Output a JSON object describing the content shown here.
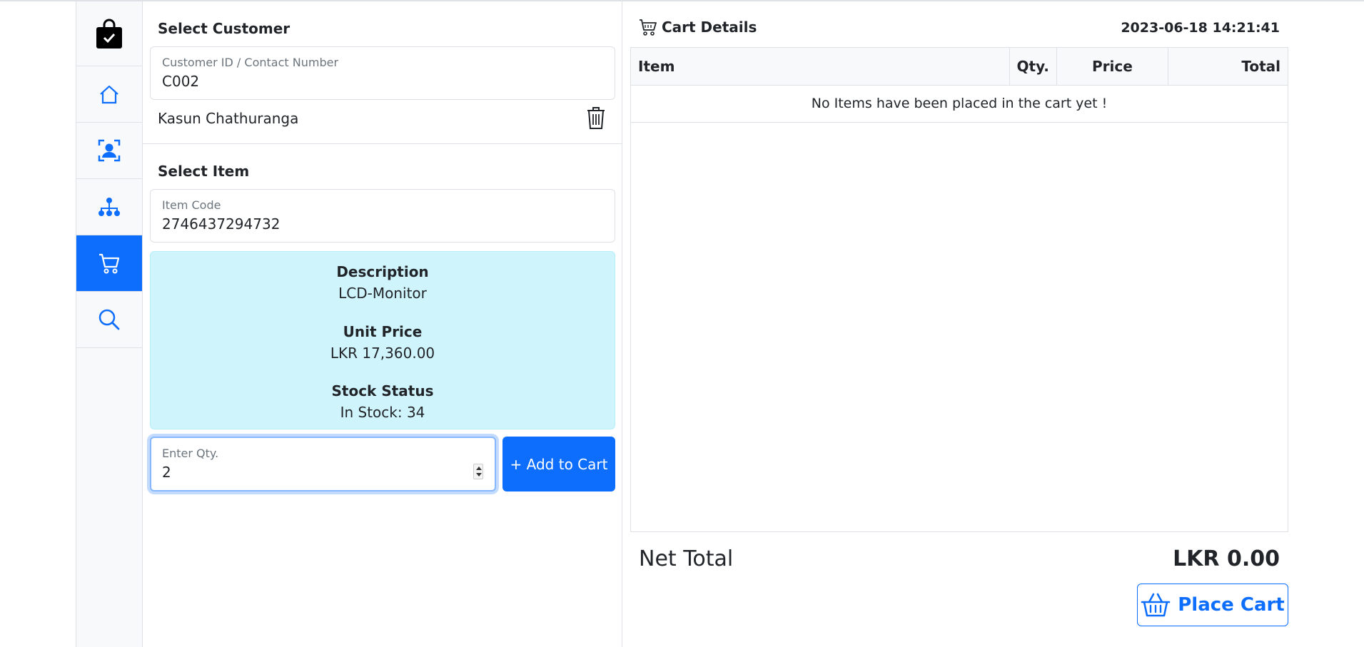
{
  "sidebar": {
    "items": [
      {
        "icon": "bag-check-icon"
      },
      {
        "icon": "home-icon"
      },
      {
        "icon": "person-badge-icon"
      },
      {
        "icon": "diagram-icon"
      },
      {
        "icon": "cart-icon",
        "active": true
      },
      {
        "icon": "search-icon"
      }
    ]
  },
  "customer": {
    "title": "Select Customer",
    "field_label": "Customer ID / Contact Number",
    "field_value": "C002",
    "name": "Kasun Chathuranga"
  },
  "item": {
    "title": "Select Item",
    "code_label": "Item Code",
    "code_value": "2746437294732",
    "description_label": "Description",
    "description_value": "LCD-Monitor",
    "price_label": "Unit Price",
    "price_value": "LKR 17,360.00",
    "stock_label": "Stock Status",
    "stock_value": "In Stock: 34",
    "qty_label": "Enter Qty.",
    "qty_value": "2",
    "add_button": "+ Add to Cart"
  },
  "cart": {
    "title": "Cart Details",
    "datetime": "2023-06-18 14:21:41",
    "columns": [
      "Item",
      "Qty.",
      "Price",
      "Total"
    ],
    "empty_message": "No Items have been placed in the cart yet !",
    "net_total_label": "Net Total",
    "net_total_value": "LKR 0.00",
    "place_button": "Place Cart"
  },
  "colors": {
    "primary": "#0d6efd",
    "info_bg": "#cff4fc",
    "sidebar_bg": "#f8f9fa"
  }
}
